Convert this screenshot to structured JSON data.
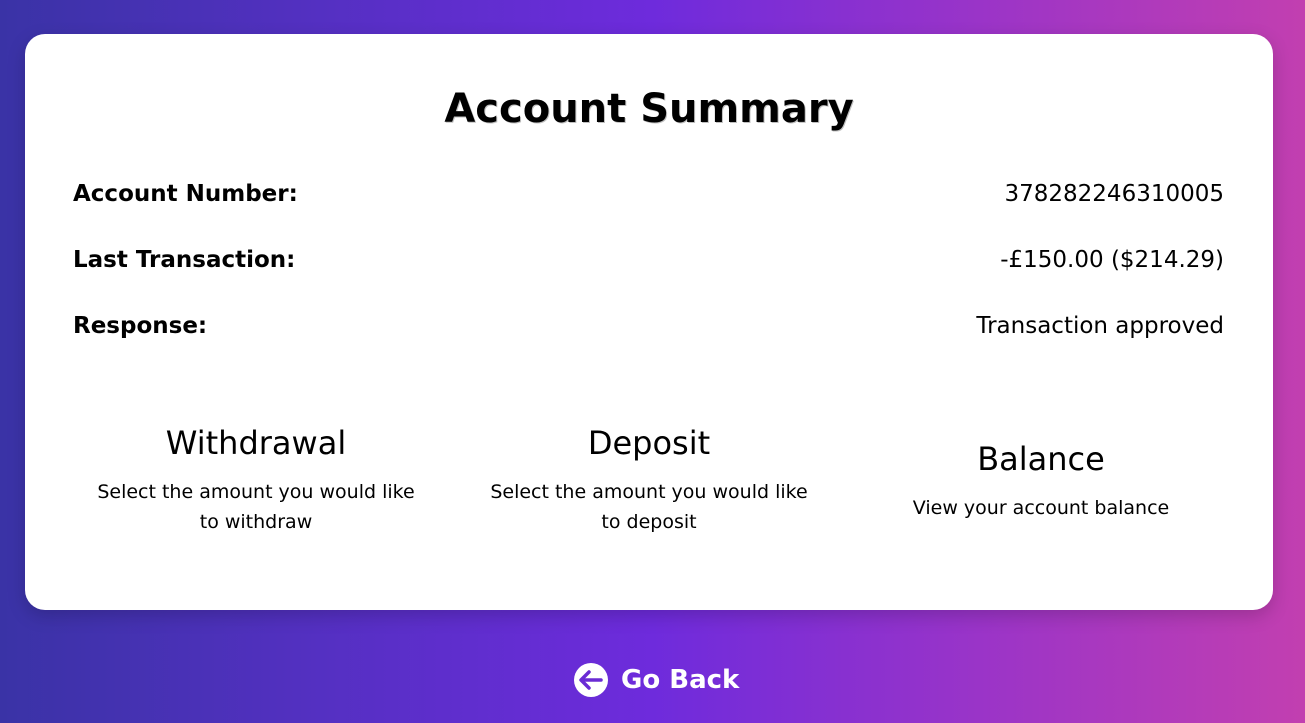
{
  "summary": {
    "title": "Account Summary",
    "rows": [
      {
        "label": "Account Number:",
        "value": "378282246310005"
      },
      {
        "label": "Last Transaction:",
        "value": "-£150.00 ($214.29)"
      },
      {
        "label": "Response:",
        "value": "Transaction approved"
      }
    ]
  },
  "options": [
    {
      "title": "Withdrawal",
      "description": "Select the amount you would like to withdraw"
    },
    {
      "title": "Deposit",
      "description": "Select the amount you would like to deposit"
    },
    {
      "title": "Balance",
      "description": "View your account balance"
    }
  ],
  "footer": {
    "go_back_label": "Go Back",
    "go_back_icon": "arrow-left-circle-icon"
  },
  "colors": {
    "gradient_start": "#3a33a6",
    "gradient_mid": "#6e2bdc",
    "gradient_end": "#c23fb0",
    "card_background": "#ffffff"
  }
}
